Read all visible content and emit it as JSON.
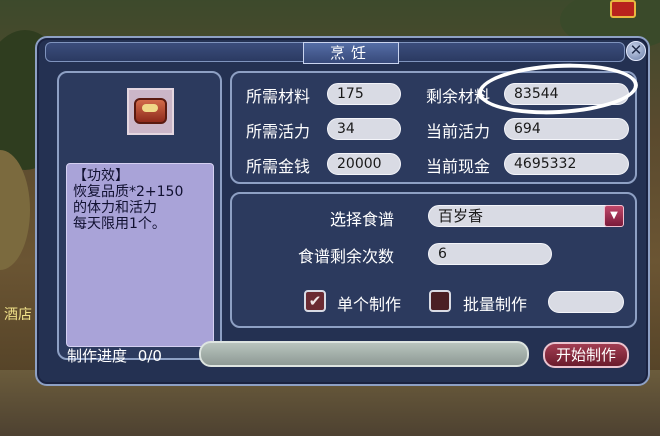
{
  "window": {
    "title": "烹饪",
    "close_symbol": "✕"
  },
  "background": {
    "side_text": "酒店"
  },
  "effect": {
    "header": "【功效】",
    "lines": [
      "恢复品质*2+150",
      "的体力和活力",
      "每天限用1个。"
    ]
  },
  "stats": {
    "required_material_label": "所需材料",
    "required_material_value": "175",
    "remaining_material_label": "剩余材料",
    "remaining_material_value": "83544",
    "required_vitality_label": "所需活力",
    "required_vitality_value": "34",
    "current_vitality_label": "当前活力",
    "current_vitality_value": "694",
    "required_money_label": "所需金钱",
    "required_money_value": "20000",
    "current_cash_label": "当前现金",
    "current_cash_value": "4695332"
  },
  "recipe": {
    "select_label": "选择食谱",
    "selected": "百岁香",
    "remaining_label": "食谱剩余次数",
    "remaining_value": "6"
  },
  "mode": {
    "single_label": "单个制作",
    "single_checked": true,
    "batch_label": "批量制作",
    "batch_checked": false,
    "batch_qty": "",
    "check_symbol": "✔"
  },
  "progress": {
    "label": "制作进度",
    "value": "0/0",
    "fraction": 0
  },
  "actions": {
    "start_label": "开始制作"
  },
  "colors": {
    "window_bg": "#243152",
    "border": "#8ea0c4",
    "field_bg": "#d9dbe4",
    "desc_bg": "#a9a3d8",
    "start_btn": "#a23d52"
  }
}
